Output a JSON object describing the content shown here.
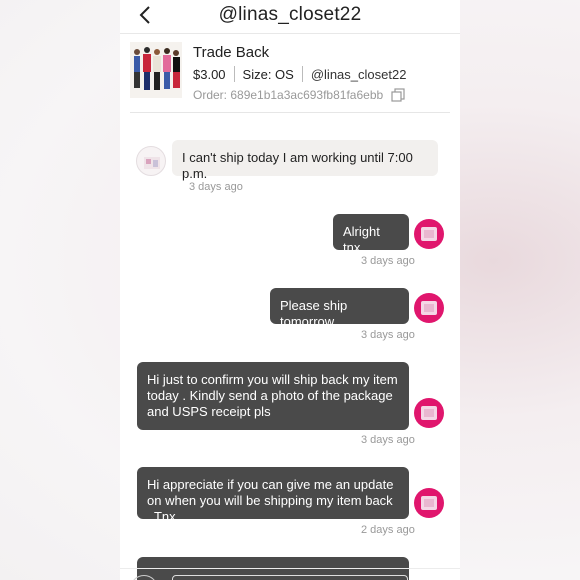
{
  "header": {
    "title": "@linas_closet22"
  },
  "listing": {
    "title": "Trade Back",
    "price": "$3.00",
    "size": "Size: OS",
    "seller": "@linas_closet22",
    "order": "Order: 689e1b1a3ac693fb81fa6ebb"
  },
  "messages": [
    {
      "direction": "received",
      "text": "I can't ship today I am working until 7:00 p.m.",
      "time": "3 days ago"
    },
    {
      "direction": "sent",
      "text": "Alright tnx",
      "time": "3 days ago"
    },
    {
      "direction": "sent",
      "text": "Please ship tomorrow",
      "time": "3 days ago"
    },
    {
      "direction": "sent",
      "text": "Hi just to confirm you will ship back my item today . Kindly send a photo of the package and USPS receipt pls",
      "time": "3 days ago"
    },
    {
      "direction": "sent",
      "text": "Hi appreciate if you can give me an update on when you will be shipping my item back . Tnx",
      "time": "2 days ago"
    }
  ],
  "colors": {
    "sent_bubble": "#4a4a4a",
    "received_bubble": "#f2f0ee",
    "sent_avatar": "#e0166d"
  }
}
